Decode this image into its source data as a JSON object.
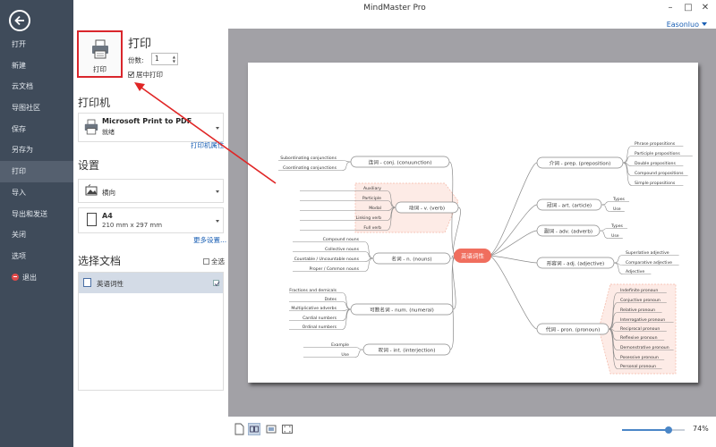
{
  "app": {
    "title": "MindMaster Pro",
    "user": "Easonluo"
  },
  "sidebar": {
    "items": [
      {
        "label": "打开"
      },
      {
        "label": "新建"
      },
      {
        "label": "云文档"
      },
      {
        "label": "导图社区"
      },
      {
        "label": "保存"
      },
      {
        "label": "另存为"
      },
      {
        "label": "打印"
      },
      {
        "label": "导入"
      },
      {
        "label": "导出和发送"
      },
      {
        "label": "关闭"
      },
      {
        "label": "选项"
      },
      {
        "label": "退出"
      }
    ],
    "active_index": 6
  },
  "print": {
    "button_label": "打印",
    "heading": "打印",
    "copies_label": "份数:",
    "copies_value": "1",
    "center_label": "居中打印",
    "center_checked": true
  },
  "printer": {
    "section_title": "打印机",
    "name": "Microsoft Print to PDF",
    "status": "就绪",
    "properties_link": "打印机属性"
  },
  "settings": {
    "section_title": "设置",
    "orientation": "横向",
    "paper_name": "A4",
    "paper_size": "210 mm x 297 mm",
    "more_link": "更多设置..."
  },
  "documents": {
    "section_title": "选择文档",
    "select_all_label": "全选",
    "items": [
      {
        "name": "英语词性",
        "checked": true
      }
    ]
  },
  "mindmap": {
    "central": "英语词性",
    "left_branches": [
      {
        "label": "连词 - conj. (conuunction)",
        "children": [
          "Subordinating conjunctions",
          "Coordinating conjunctions"
        ]
      },
      {
        "label": "动词 - v. (verb)",
        "children": [
          "Auxiliary",
          "Participle",
          "Modal",
          "Linking verb",
          "Full  verb"
        ]
      },
      {
        "label": "名词 - n. (nouns)",
        "children": [
          "Compound nouns",
          "Collective nouns",
          "Countable / Uncountable nouns",
          "Proper / Common nouns"
        ]
      },
      {
        "label": "可数名词 - num. (numeral)",
        "children": [
          "Fractions and demicals",
          "Dates",
          "Multiplicative adverbs",
          "Cardial numbers",
          "Ordinal numbers"
        ]
      },
      {
        "label": "叹词 - int. (interjection)",
        "children": [
          "Example",
          "Use"
        ]
      }
    ],
    "right_branches": [
      {
        "label": "介词 - prep. (preposition)",
        "children": [
          "Phrase propositions",
          "Participle propositions",
          "Double propositions",
          "Compound propositions",
          "Simple propositions"
        ]
      },
      {
        "label": "冠词 - art. (article)",
        "children": [
          "Types",
          "Use"
        ]
      },
      {
        "label": "副词 - adv. (adverb)",
        "children": [
          "Types",
          "Use"
        ]
      },
      {
        "label": "形容词 - adj. (adjective)",
        "children": [
          "Superlative adjective",
          "Comparative adjective",
          "Adjective"
        ]
      },
      {
        "label": "代词 - pron. (pronoun)",
        "children": [
          "Indefinite pronoun",
          "Conjuctive pronoun",
          "Relative pronoun",
          "Interrogative pronoun",
          "Reciprocal pronoun",
          "Reflexive pronoun",
          "Demonstrative pronoun",
          "Posessive pronoun",
          "Personal pronoun"
        ]
      }
    ]
  },
  "zoom": {
    "value": "74%",
    "fraction": 0.74
  },
  "colors": {
    "sidebar_bg": "#3f4b5a",
    "central_topic": "#f06e5e",
    "highlight": "#d9262c",
    "link": "#1a5fb4"
  }
}
